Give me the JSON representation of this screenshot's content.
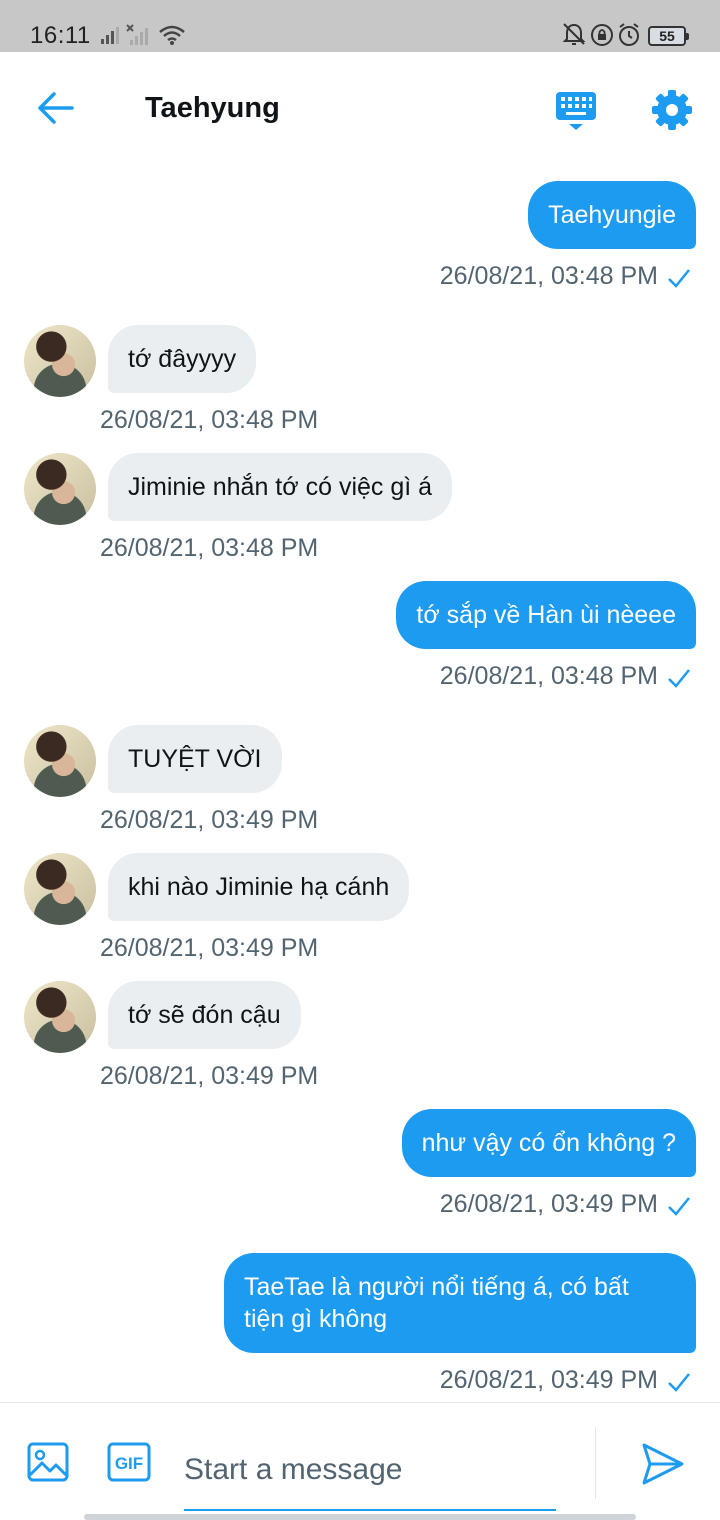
{
  "status_bar": {
    "time": "16:11",
    "battery": "55"
  },
  "header": {
    "title": "Taehyung"
  },
  "messages": [
    {
      "dir": "out",
      "text": "Taehyungie",
      "timestamp": "26/08/21, 03:48 PM"
    },
    {
      "dir": "in",
      "text": "tớ đâyyyy",
      "timestamp": "26/08/21, 03:48 PM"
    },
    {
      "dir": "in",
      "text": "Jiminie nhắn tớ có việc gì á",
      "timestamp": "26/08/21, 03:48 PM"
    },
    {
      "dir": "out",
      "text": "tớ sắp về Hàn ùi nèeee",
      "timestamp": "26/08/21, 03:48 PM"
    },
    {
      "dir": "in",
      "text": "TUYỆT VỜI",
      "timestamp": "26/08/21, 03:49 PM"
    },
    {
      "dir": "in",
      "text": "khi nào Jiminie hạ cánh",
      "timestamp": "26/08/21, 03:49 PM"
    },
    {
      "dir": "in",
      "text": "tớ sẽ đón cậu",
      "timestamp": "26/08/21, 03:49 PM"
    },
    {
      "dir": "out",
      "text": "như vậy có ổn không ?",
      "timestamp": "26/08/21, 03:49 PM"
    },
    {
      "dir": "out",
      "text": "TaeTae là người nổi tiếng á, có bất tiện gì không",
      "timestamp": "26/08/21, 03:49 PM"
    }
  ],
  "composer": {
    "placeholder": "Start a message",
    "gif_label": "GIF"
  },
  "colors": {
    "accent": "#1d9bf0",
    "incoming_bubble": "#eaeef1",
    "timestamp": "#536471"
  }
}
